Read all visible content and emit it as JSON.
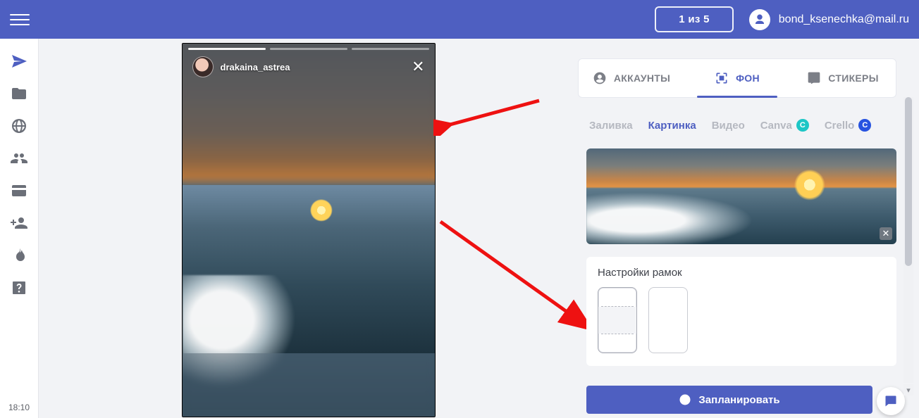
{
  "header": {
    "counter": "1 из 5",
    "user_email": "bond_ksenechka@mail.ru"
  },
  "rail": {
    "time": "18:10"
  },
  "story": {
    "username": "drakaina_astrea",
    "segments": 3
  },
  "panel": {
    "tabs": {
      "accounts": "АККАУНТЫ",
      "background": "ФОН",
      "stickers": "СТИКЕРЫ"
    },
    "subtabs": {
      "fill": "Заливка",
      "image": "Картинка",
      "video": "Видео",
      "canva": "Canva",
      "crello": "Crello"
    },
    "frames_title": "Настройки рамок",
    "schedule_label": "Запланировать"
  }
}
